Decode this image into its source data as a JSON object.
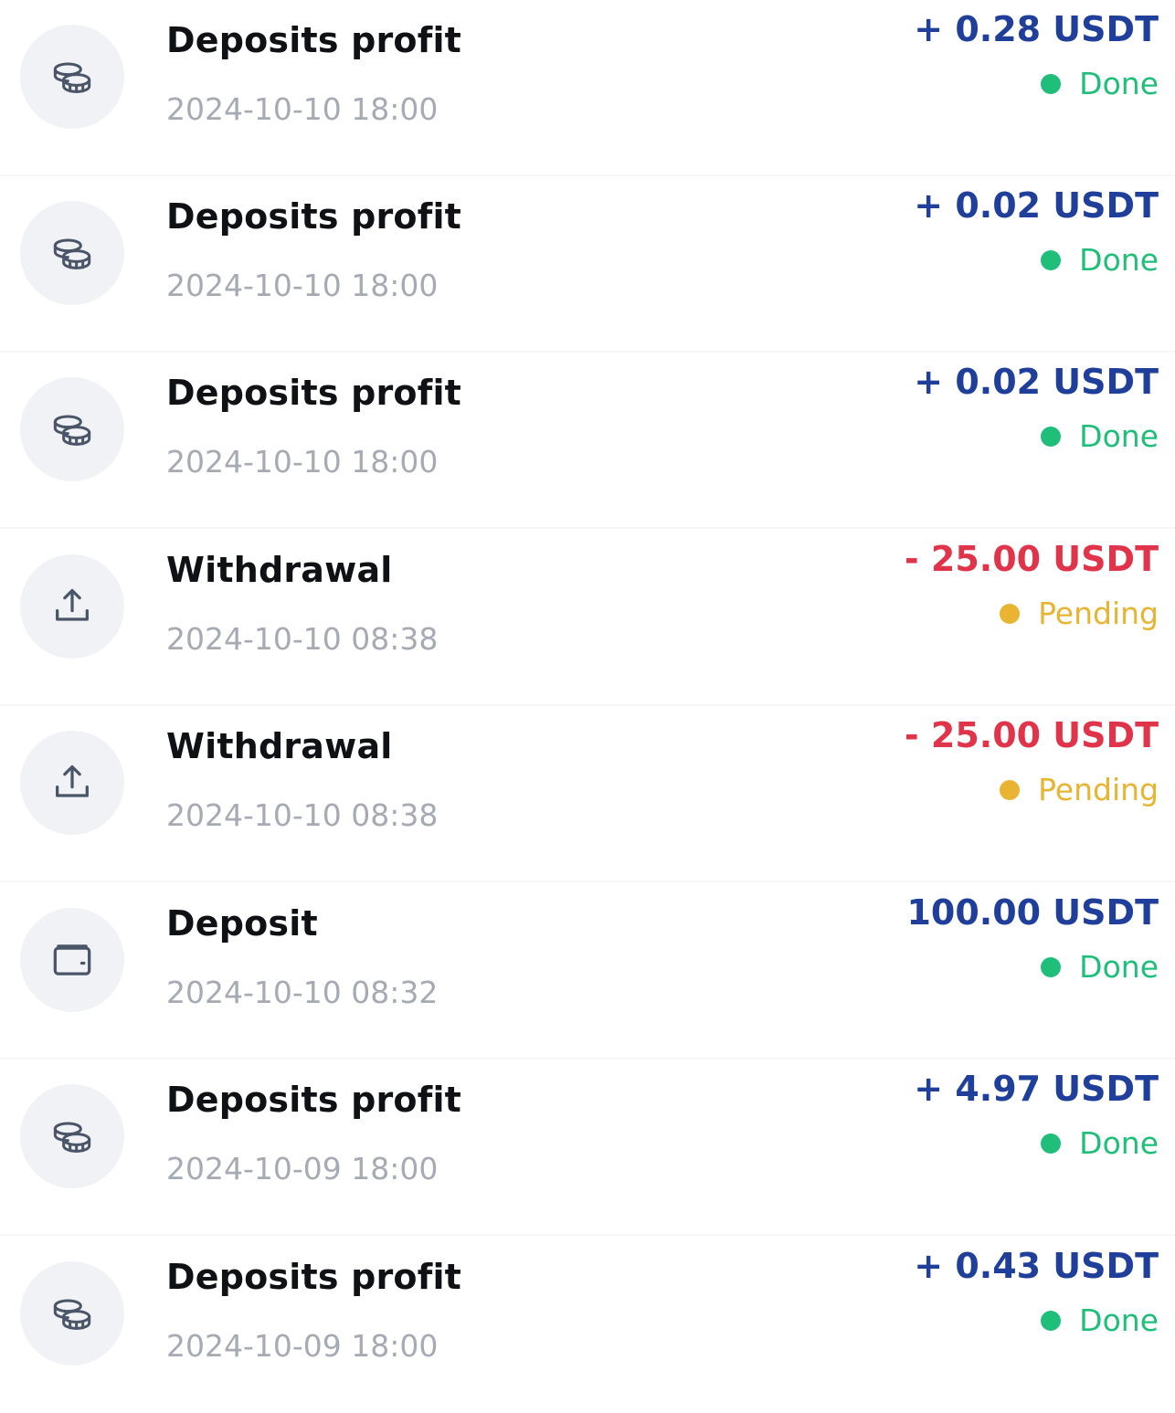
{
  "transactions": [
    {
      "title": "Deposits profit",
      "date": "2024-10-10 18:00",
      "amount": "+ 0.28 USDT",
      "direction": "positive",
      "status": "Done",
      "icon": "coins-icon"
    },
    {
      "title": "Deposits profit",
      "date": "2024-10-10 18:00",
      "amount": "+ 0.02 USDT",
      "direction": "positive",
      "status": "Done",
      "icon": "coins-icon"
    },
    {
      "title": "Deposits profit",
      "date": "2024-10-10 18:00",
      "amount": "+ 0.02 USDT",
      "direction": "positive",
      "status": "Done",
      "icon": "coins-icon"
    },
    {
      "title": "Withdrawal",
      "date": "2024-10-10 08:38",
      "amount": "- 25.00 USDT",
      "direction": "negative",
      "status": "Pending",
      "icon": "upload-icon"
    },
    {
      "title": "Withdrawal",
      "date": "2024-10-10 08:38",
      "amount": "- 25.00 USDT",
      "direction": "negative",
      "status": "Pending",
      "icon": "upload-icon"
    },
    {
      "title": "Deposit",
      "date": "2024-10-10 08:32",
      "amount": "100.00 USDT",
      "direction": "positive",
      "status": "Done",
      "icon": "wallet-icon"
    },
    {
      "title": "Deposits profit",
      "date": "2024-10-09 18:00",
      "amount": "+ 4.97 USDT",
      "direction": "positive",
      "status": "Done",
      "icon": "coins-icon"
    },
    {
      "title": "Deposits profit",
      "date": "2024-10-09 18:00",
      "amount": "+ 0.43 USDT",
      "direction": "positive",
      "status": "Done",
      "icon": "coins-icon"
    }
  ],
  "colors": {
    "amount_positive": "#1f3f9a",
    "amount_negative": "#e0344a",
    "status_done": "#1fbf7a",
    "status_pending": "#e8b431",
    "title": "#0f1115",
    "date": "#a6aab3",
    "icon_bg": "#f1f2f5",
    "icon_stroke": "#4a5568"
  }
}
